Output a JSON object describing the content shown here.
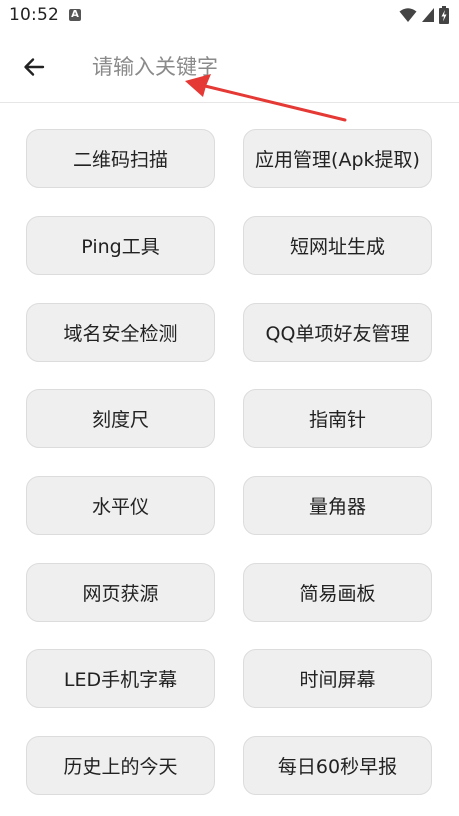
{
  "status_bar": {
    "time": "10:52",
    "notification_icon": "a-badge-icon",
    "wifi_icon": "wifi-icon",
    "signal_icon": "signal-icon",
    "battery_icon": "battery-charging-icon"
  },
  "app_bar": {
    "back_icon": "arrow-left-icon",
    "search_placeholder": "请输入关键字",
    "search_value": ""
  },
  "annotation": {
    "arrow_color": "#e53935"
  },
  "tools": [
    {
      "label": "二维码扫描"
    },
    {
      "label": "应用管理(Apk提取)"
    },
    {
      "label": "Ping工具"
    },
    {
      "label": "短网址生成"
    },
    {
      "label": "域名安全检测"
    },
    {
      "label": "QQ单项好友管理"
    },
    {
      "label": "刻度尺"
    },
    {
      "label": "指南针"
    },
    {
      "label": "水平仪"
    },
    {
      "label": "量角器"
    },
    {
      "label": "网页获源"
    },
    {
      "label": "简易画板"
    },
    {
      "label": "LED手机字幕"
    },
    {
      "label": "时间屏幕"
    },
    {
      "label": "历史上的今天"
    },
    {
      "label": "每日60秒早报"
    }
  ]
}
